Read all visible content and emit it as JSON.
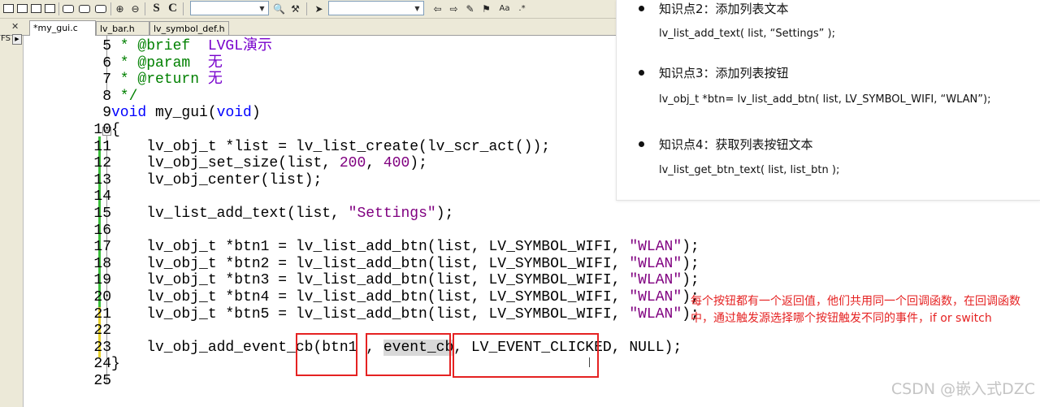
{
  "editor": {
    "tabs": [
      "*my_gui.c",
      "lv_bar.h",
      "lv_symbol_def.h"
    ],
    "lines": [
      {
        "n": "5",
        "segs": [
          {
            "t": " * @brief  ",
            "c": "cmt"
          },
          {
            "t": "LVGL演示",
            "c": "doc"
          }
        ]
      },
      {
        "n": "6",
        "segs": [
          {
            "t": " * @param  ",
            "c": "cmt"
          },
          {
            "t": "无",
            "c": "doc"
          }
        ]
      },
      {
        "n": "7",
        "segs": [
          {
            "t": " * @return ",
            "c": "cmt"
          },
          {
            "t": "无",
            "c": "doc"
          }
        ]
      },
      {
        "n": "8",
        "segs": [
          {
            "t": " */",
            "c": "cmt"
          }
        ]
      },
      {
        "n": "9",
        "segs": [
          {
            "t": "void",
            "c": "kw"
          },
          {
            "t": " my_gui("
          },
          {
            "t": "void",
            "c": "kw"
          },
          {
            "t": ")"
          }
        ]
      },
      {
        "n": "10",
        "segs": [
          {
            "t": "{"
          }
        ]
      },
      {
        "n": "11",
        "segs": [
          {
            "t": "    lv_obj_t *list = lv_list_create(lv_scr_act());"
          }
        ]
      },
      {
        "n": "12",
        "segs": [
          {
            "t": "    lv_obj_set_size(list, "
          },
          {
            "t": "200",
            "c": "num"
          },
          {
            "t": ", "
          },
          {
            "t": "400",
            "c": "num"
          },
          {
            "t": ");"
          }
        ]
      },
      {
        "n": "13",
        "segs": [
          {
            "t": "    lv_obj_center(list);"
          }
        ]
      },
      {
        "n": "14",
        "segs": []
      },
      {
        "n": "15",
        "segs": [
          {
            "t": "    lv_list_add_text(list, "
          },
          {
            "t": "\"Settings\"",
            "c": "str"
          },
          {
            "t": ");"
          }
        ]
      },
      {
        "n": "16",
        "segs": []
      },
      {
        "n": "17",
        "segs": [
          {
            "t": "    lv_obj_t *btn1 = lv_list_add_btn(list, LV_SYMBOL_WIFI, "
          },
          {
            "t": "\"WLAN\"",
            "c": "str"
          },
          {
            "t": ");"
          }
        ]
      },
      {
        "n": "18",
        "segs": [
          {
            "t": "    lv_obj_t *btn2 = lv_list_add_btn(list, LV_SYMBOL_WIFI, "
          },
          {
            "t": "\"WLAN\"",
            "c": "str"
          },
          {
            "t": ");"
          }
        ]
      },
      {
        "n": "19",
        "segs": [
          {
            "t": "    lv_obj_t *btn3 = lv_list_add_btn(list, LV_SYMBOL_WIFI, "
          },
          {
            "t": "\"WLAN\"",
            "c": "str"
          },
          {
            "t": ");"
          }
        ]
      },
      {
        "n": "20",
        "segs": [
          {
            "t": "    lv_obj_t *btn4 = lv_list_add_btn(list, LV_SYMBOL_WIFI, "
          },
          {
            "t": "\"WLAN\"",
            "c": "str"
          },
          {
            "t": ");"
          }
        ]
      },
      {
        "n": "21",
        "segs": [
          {
            "t": "    lv_obj_t *btn5 = lv_list_add_btn(list, LV_SYMBOL_WIFI, "
          },
          {
            "t": "\"WLAN\"",
            "c": "str"
          },
          {
            "t": ");"
          }
        ]
      },
      {
        "n": "22",
        "segs": []
      },
      {
        "n": "23",
        "segs": [
          {
            "t": "    lv_obj_add_event_cb(btn1 , "
          },
          {
            "t": "event_cb",
            "c": "sel"
          },
          {
            "t": ", LV_EVENT_CLICKED, NULL);"
          }
        ]
      },
      {
        "n": "24",
        "segs": [
          {
            "t": "}"
          }
        ]
      },
      {
        "n": "25",
        "segs": []
      }
    ]
  },
  "notes": {
    "items": [
      {
        "title": "知识点2：添加列表文本",
        "code": "lv_list_add_text( list, “Settings” );"
      },
      {
        "title": "知识点3：添加列表按钮",
        "code": "lv_obj_t  *btn= lv_list_add_btn( list, LV_SYMBOL_WIFI, “WLAN”);"
      },
      {
        "title": "知识点4：获取列表按钮文本",
        "code": "lv_list_get_btn_text( list, list_btn );"
      }
    ]
  },
  "annotation": "每个按钮都有一个返回值，他们共用同一个回调函数，在回调函数中，通过触发源选择哪个按钮触发不同的事件，if  or switch",
  "watermark": "CSDN @嵌入式DZC",
  "sidebar": {
    "label": "FS"
  },
  "colors": {
    "accent_red": "#e52222",
    "keyword": "#0000ff",
    "comment": "#008000",
    "string": "#800080"
  }
}
